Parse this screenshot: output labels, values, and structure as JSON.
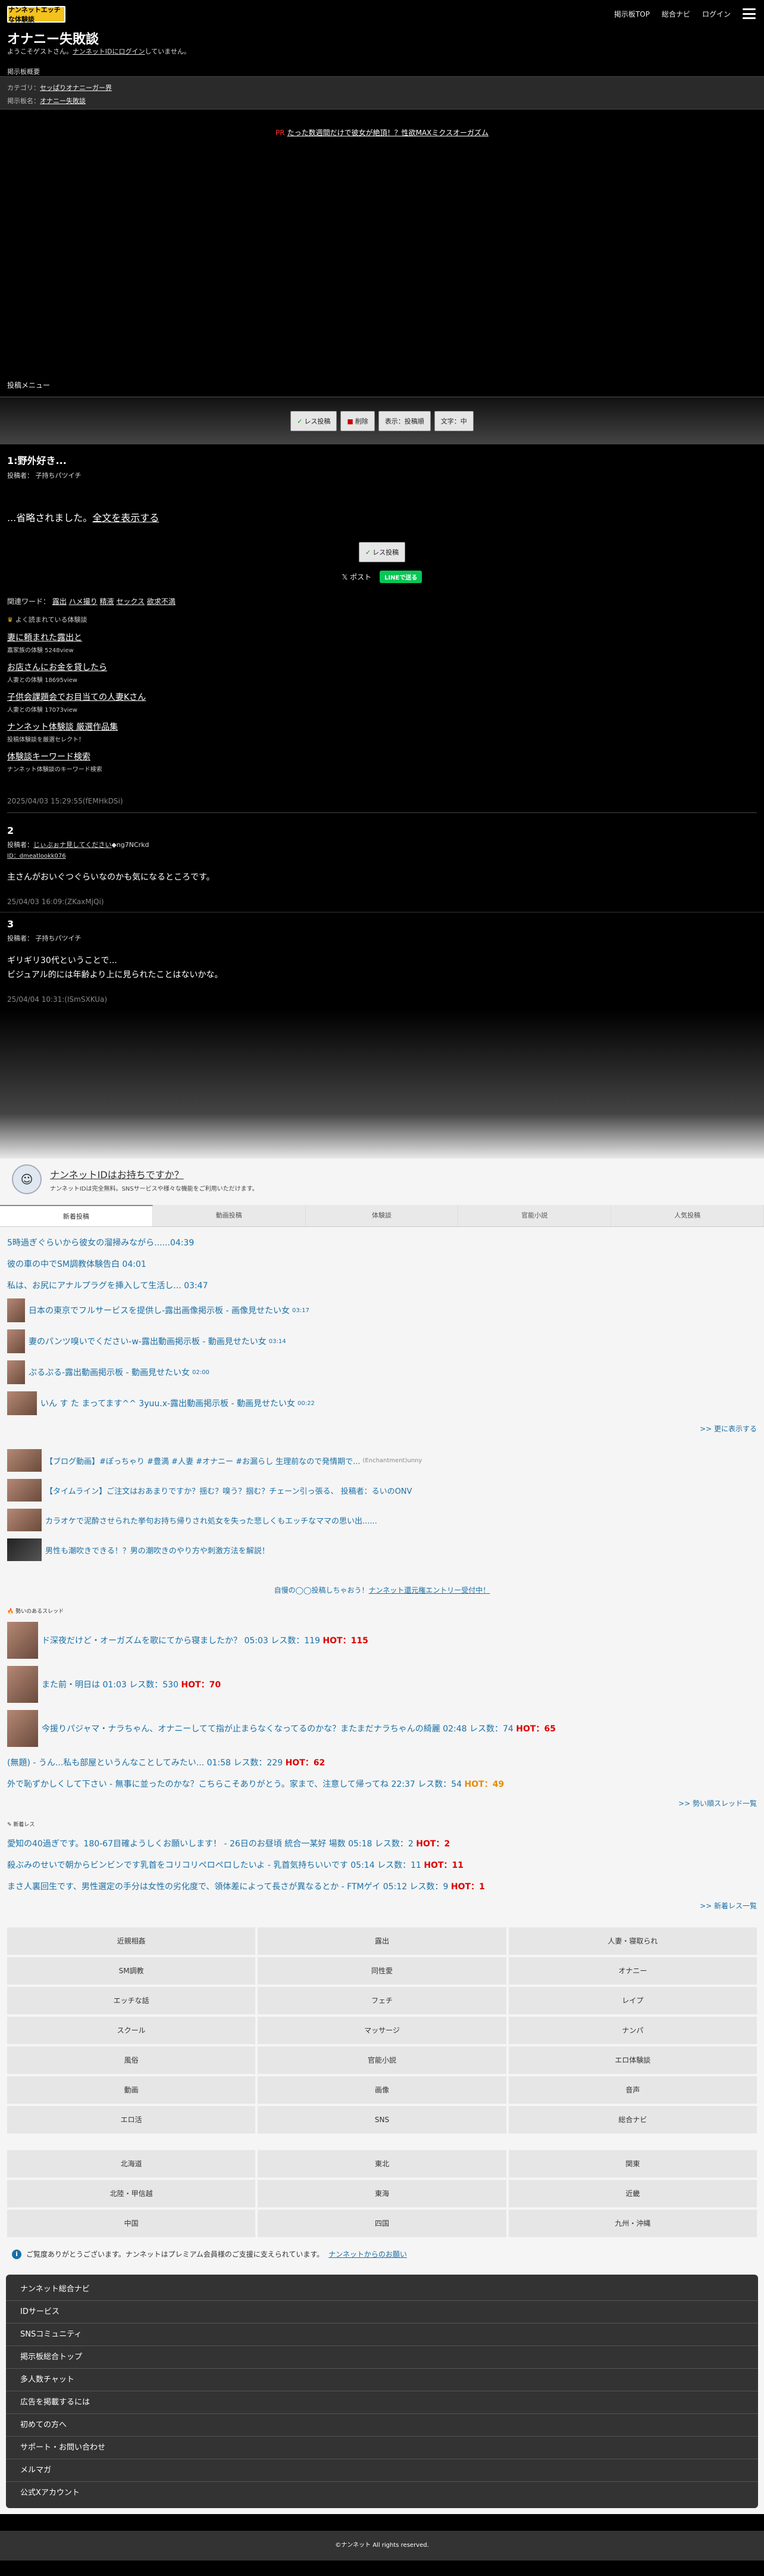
{
  "header": {
    "logo_text": "ナンネットエッチな体験談",
    "nav": [
      "掲示板TOP",
      "総合ナビ",
      "ログイン"
    ],
    "title": "オナニー失敗談",
    "welcome_pre": "ようこそゲストさん。",
    "welcome_link": "ナンネットIDにログイン",
    "welcome_post": "していません。",
    "board_summary": "掲示板概要"
  },
  "meta": {
    "category_label": "カテゴリ：",
    "category": "セッぱりオナニーガー界",
    "board_label": "掲示板名：",
    "board": "オナニー失敗談"
  },
  "promo": {
    "prefix": "PR",
    "text": "たった数週間だけで彼女が絶頂！？性欲MAXミクスオーガズム"
  },
  "post_menu": "投稿メニュー",
  "toolbar": [
    "レス投稿",
    "削除",
    "表示：投稿順",
    "文字：中"
  ],
  "main_post": {
    "number_title": "1:野外好き...",
    "poster": "投稿者： 子持ちパツイチ",
    "omitted_pre": "...省略されました。",
    "omitted_link": "全文を表示する",
    "reply_button": "レス投稿",
    "share_x": "ポスト",
    "share_line": "LINEで送る",
    "related_label": "関連ワード：",
    "related": [
      "露出",
      "ハメ撮り",
      "精液",
      "セックス",
      "欲求不満"
    ],
    "rec_title": "よく読まれている体験談",
    "recs": [
      {
        "title": "妻に頼まれた露出と",
        "sub": "嘉家族の体験 5248view"
      },
      {
        "title": "お店さんにお金を貸したら",
        "sub": "人妻との体験 18695view"
      },
      {
        "title": "子供会課題会でお目当ての人妻Kさん",
        "sub": "人妻との体験 17073view"
      },
      {
        "title": "ナンネット体験談 厳選作品集",
        "sub": "投稿体験談を厳選セレクト！"
      },
      {
        "title": "体験談キーワード検索",
        "sub": "ナンネット体験談のキーワード検索"
      }
    ],
    "footer": "2025/04/03 15:29:55(fEMHkDSi)"
  },
  "replies": [
    {
      "num": "2",
      "poster_pre": "投稿者：",
      "poster_link": "じぃぶぉナ見してください",
      "poster_post": "◆ng7NCrkd",
      "id_line": "ID：dmeatlookk076",
      "body": "主さんがおいぐつぐらいなのかも気になるところです。",
      "footer": "25/04/03 16:09:(ZKaxMjQi)"
    },
    {
      "num": "3",
      "poster_pre": "投稿者： 子持ちパツイチ",
      "poster_link": "",
      "poster_post": "",
      "id_line": "",
      "body": "ギリギリ30代ということで...\nビジュアル的には年齢より上に見られたことはないかな。",
      "footer": "25/04/04 10:31:(ISmSXKUa)"
    }
  ],
  "nanet": {
    "title": "ナンネットIDはお持ちですか？",
    "sub": "ナンネットIDは完全無料。SNSサービスや様々な機能をご利用いただけます。"
  },
  "tabs": [
    "新着投稿",
    "動画投稿",
    "体験談",
    "官能小説",
    "人気投稿"
  ],
  "feed_text": [
    "5時過ぎぐらいから彼女の溜掃みながら......04:39",
    "彼の車の中でSM調教体験告白 04:01",
    "私は、お尻にアナルプラグを挿入して生活し... 03:47"
  ],
  "feed_img": [
    {
      "t": "日本の東京でフルサービスを提供し-露出画像掲示板 - 画像見せたい女",
      "tm": "03:17"
    },
    {
      "t": "妻のパンツ嗅いでください-w-露出動画掲示板 - 動画見せたい女",
      "tm": "03:14"
    },
    {
      "t": "ぷるぷる-露出動画掲示板 - 動画見せたい女",
      "tm": "02:00"
    },
    {
      "t": "いん す た まってます^^ 3yuu.x-露出動画掲示板 - 動画見せたい女",
      "tm": "00:22"
    }
  ],
  "more1": ">> 更に表示する",
  "ads": [
    {
      "t": "【ブログ動画】#ぽっちゃり #豊満 #人妻 #オナニー #お漏らし 生理前なので発情期で...",
      "s": "(Enchantment)unny"
    },
    {
      "t": "【タイムライン】ご注文はおあまりですか？揺む？嗅う？掴む？チェーン引っ張る、 投稿者：るいのONV",
      "s": ""
    },
    {
      "t": "カラオケで泥酔させられた挙句お持ち帰りされ処女を失った悲しくもエッチなママの思い出......",
      "s": ""
    },
    {
      "t": "男性も潮吹きできる！？男の潮吹きのやり方や刺激方法を解説！",
      "s": ""
    }
  ],
  "cta": {
    "pre": "自慢の◯◯投稿しちゃおう！",
    "link": "ナンネット還元権エントリー受付中！"
  },
  "hot_head": "勢いのあるスレッド",
  "hot_img": [
    {
      "t": "ド深夜だけど・オーガズムを歌にてから寝ましたか？ 05:03 レス数：119 ",
      "hot": "HOT：115"
    },
    {
      "t": "また前・明日は 01:03 レス数：530 ",
      "hot": "HOT：70"
    },
    {
      "t": "今援りパジャマ・ナラちゃん、オナニーしてて指が止まらなくなってるのかな？またまだナラちゃんの綺麗 02:48 レス数：74 ",
      "hot": "HOT：65"
    }
  ],
  "hot_plain": [
    {
      "t": "(無題) - うん...私も部屋というんなことしてみたい... 01:58 レス数：229 ",
      "hot": "HOT：62",
      "cls": "hot"
    },
    {
      "t": "外で恥ずかしくして下さい - 無事に並ったのかな？こちらこそありがとう。家まで、注意して帰ってね 22:37 レス数：54 ",
      "hot": "HOT：49",
      "cls": "hot-o"
    }
  ],
  "more2": ">> 勢い順スレッド一覧",
  "new_head": "新着レス",
  "new_res": [
    {
      "t": "愛知の40過ぎです。180-67目確ようしくお願いします！ - 26日のお昼頃 統合一某好 場数 05:18 レス数：2 ",
      "hot": "HOT：2"
    },
    {
      "t": "殺ぶみのせいで朝からビンビンです乳首をコリコリペロペロしたいよ - 乳首気持ちいいです 05:14 レス数：11 ",
      "hot": "HOT：11"
    },
    {
      "t": "まさ人裏回生です、男性選定の手分は女性の劣化度で、領体差によって長さが異なるとか - FTMゲイ 05:12 レス数：9 ",
      "hot": "HOT：1"
    }
  ],
  "more3": ">> 新着レス一覧",
  "grid1": [
    "近親相姦",
    "露出",
    "人妻・寝取られ",
    "SM調教",
    "同性愛",
    "オナニー",
    "エッチな話",
    "フェチ",
    "レイプ",
    "スクール",
    "マッサージ",
    "ナンパ",
    "風俗",
    "官能小説",
    "エロ体験談",
    "動画",
    "画像",
    "音声",
    "エロ活",
    "SNS",
    "総合ナビ"
  ],
  "grid2": [
    "北海道",
    "東北",
    "関東",
    "北陸・甲信越",
    "東海",
    "近畿",
    "中国",
    "四国",
    "九州・沖縄"
  ],
  "info": {
    "text": "ご覧度ありがとうございます。ナンネットはプレミアム会員様のご支援に支えられています。",
    "link": "ナンネットからのお願い"
  },
  "footer_nav": [
    "ナンネット総合ナビ",
    "IDサービス",
    "SNSコミュニティ",
    "掲示板総合トップ",
    "多人数チャット",
    "広告を掲載するには",
    "初めての方へ",
    "サポート・お問い合わせ",
    "メルマガ",
    "公式Xアカウント"
  ],
  "copyright": "©ナンネット All rights reserved."
}
